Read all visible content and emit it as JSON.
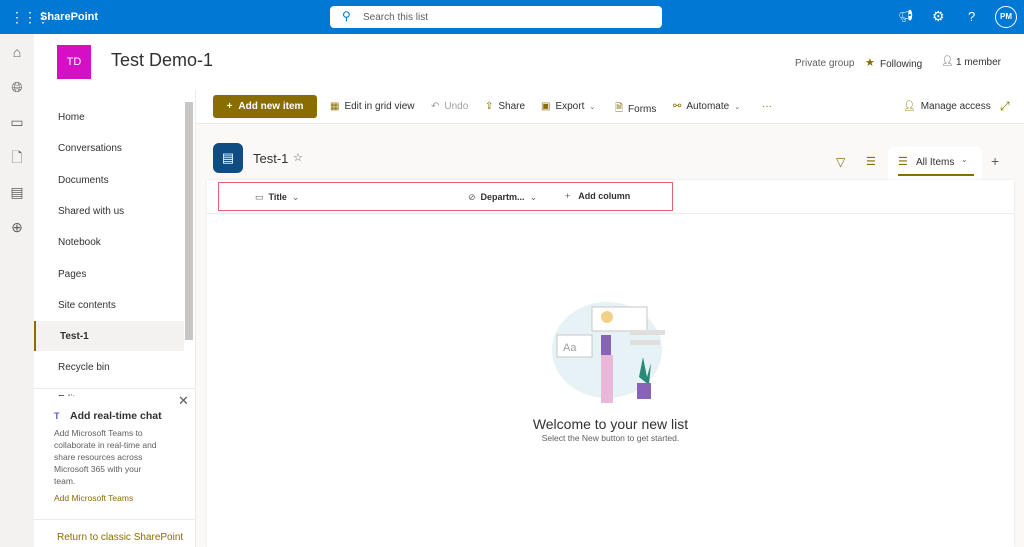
{
  "topbar": {
    "app": "SharePoint",
    "search_placeholder": "Search this list",
    "avatar": "PM",
    "color": "#0078d4"
  },
  "site": {
    "logo": "TD",
    "title": "Test Demo-1",
    "privacy": "Private group",
    "following": "Following",
    "members": "1 member",
    "logo_color": "#d40fc4"
  },
  "nav": {
    "items": [
      "Home",
      "Conversations",
      "Documents",
      "Shared with us",
      "Notebook",
      "Pages",
      "Site contents",
      "Test-1",
      "Recycle bin",
      "Edit"
    ],
    "selected": "Test-1"
  },
  "teams_promo": {
    "title": "Add real-time chat",
    "body": "Add Microsoft Teams to collaborate in real-time and share resources across Microsoft 365 with your team.",
    "link": "Add Microsoft Teams"
  },
  "return_link": "Return to classic SharePoint",
  "commands": {
    "add": "Add new item",
    "grid": "Edit in grid view",
    "undo": "Undo",
    "share": "Share",
    "export": "Export",
    "forms": "Forms",
    "automate": "Automate",
    "more": "···",
    "manage": "Manage access"
  },
  "list": {
    "title": "Test-1",
    "view": "All Items",
    "columns": [
      "Title",
      "Departm...",
      "Add column"
    ]
  },
  "empty": {
    "title": "Welcome to your new list",
    "subtitle": "Select the New button to get started."
  },
  "accent": "#8a6d00"
}
